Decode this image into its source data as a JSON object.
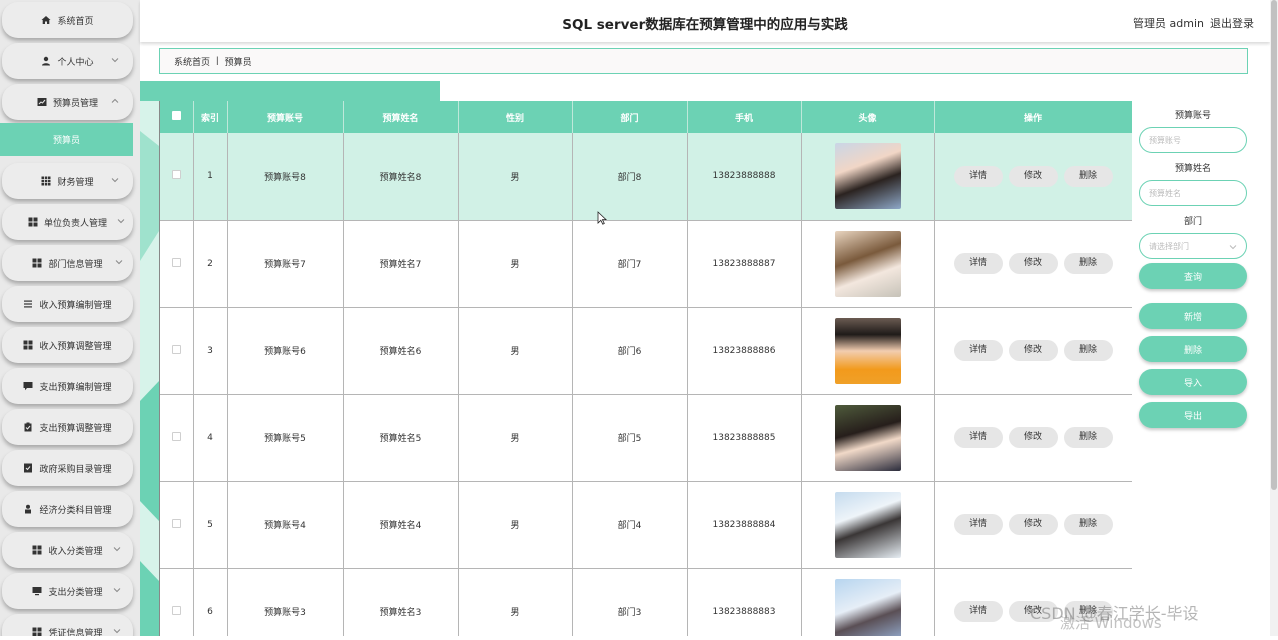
{
  "header": {
    "title": "SQL server数据库在预算管理中的应用与实践",
    "admin_label": "管理员 admin",
    "logout_label": "退出登录"
  },
  "sidebar": {
    "items": [
      {
        "label": "系统首页",
        "icon": "home-icon"
      },
      {
        "label": "个人中心",
        "icon": "user-icon"
      },
      {
        "label": "预算员管理",
        "icon": "chart-icon"
      },
      {
        "label": "财务管理",
        "icon": "grid-icon"
      },
      {
        "label": "单位负责人管理",
        "icon": "apps-icon"
      },
      {
        "label": "部门信息管理",
        "icon": "apps-icon"
      },
      {
        "label": "收入预算编制管理",
        "icon": "list-icon"
      },
      {
        "label": "收入预算调整管理",
        "icon": "apps-icon"
      },
      {
        "label": "支出预算编制管理",
        "icon": "chat-icon"
      },
      {
        "label": "支出预算调整管理",
        "icon": "clipboard-icon"
      },
      {
        "label": "政府采购目录管理",
        "icon": "check-doc-icon"
      },
      {
        "label": "经济分类科目管理",
        "icon": "person-icon"
      },
      {
        "label": "收入分类管理",
        "icon": "apps-icon"
      },
      {
        "label": "支出分类管理",
        "icon": "monitor-icon"
      },
      {
        "label": "凭证信息管理",
        "icon": "apps-icon"
      }
    ],
    "active_sub": "预算员"
  },
  "breadcrumb": {
    "home": "系统首页",
    "current": "预算员"
  },
  "table": {
    "columns": [
      "索引",
      "预算账号",
      "预算姓名",
      "性别",
      "部门",
      "手机",
      "头像",
      "操作"
    ],
    "rows": [
      {
        "index": "1",
        "account": "预算账号8",
        "name": "预算姓名8",
        "gender": "男",
        "dept": "部门8",
        "phone": "13823888888"
      },
      {
        "index": "2",
        "account": "预算账号7",
        "name": "预算姓名7",
        "gender": "男",
        "dept": "部门7",
        "phone": "13823888887"
      },
      {
        "index": "3",
        "account": "预算账号6",
        "name": "预算姓名6",
        "gender": "男",
        "dept": "部门6",
        "phone": "13823888886"
      },
      {
        "index": "4",
        "account": "预算账号5",
        "name": "预算姓名5",
        "gender": "男",
        "dept": "部门5",
        "phone": "13823888885"
      },
      {
        "index": "5",
        "account": "预算账号4",
        "name": "预算姓名4",
        "gender": "男",
        "dept": "部门4",
        "phone": "13823888884"
      },
      {
        "index": "6",
        "account": "预算账号3",
        "name": "预算姓名3",
        "gender": "男",
        "dept": "部门3",
        "phone": "13823888883"
      }
    ],
    "actions": {
      "detail": "详情",
      "edit": "修改",
      "delete": "删除"
    }
  },
  "search": {
    "account_label": "预算账号",
    "account_placeholder": "预算账号",
    "name_label": "预算姓名",
    "name_placeholder": "预算姓名",
    "dept_label": "部门",
    "dept_placeholder": "请选择部门",
    "query_button": "查询"
  },
  "actions": {
    "add": "新增",
    "delete": "删除",
    "import": "导入",
    "export": "导出"
  },
  "colors": {
    "accent": "#6cd2b4",
    "highlight_row": "#d1f1e6"
  },
  "watermark": {
    "csdn": "CSDN @春江学长-毕设",
    "windows": "激活 Windows"
  }
}
